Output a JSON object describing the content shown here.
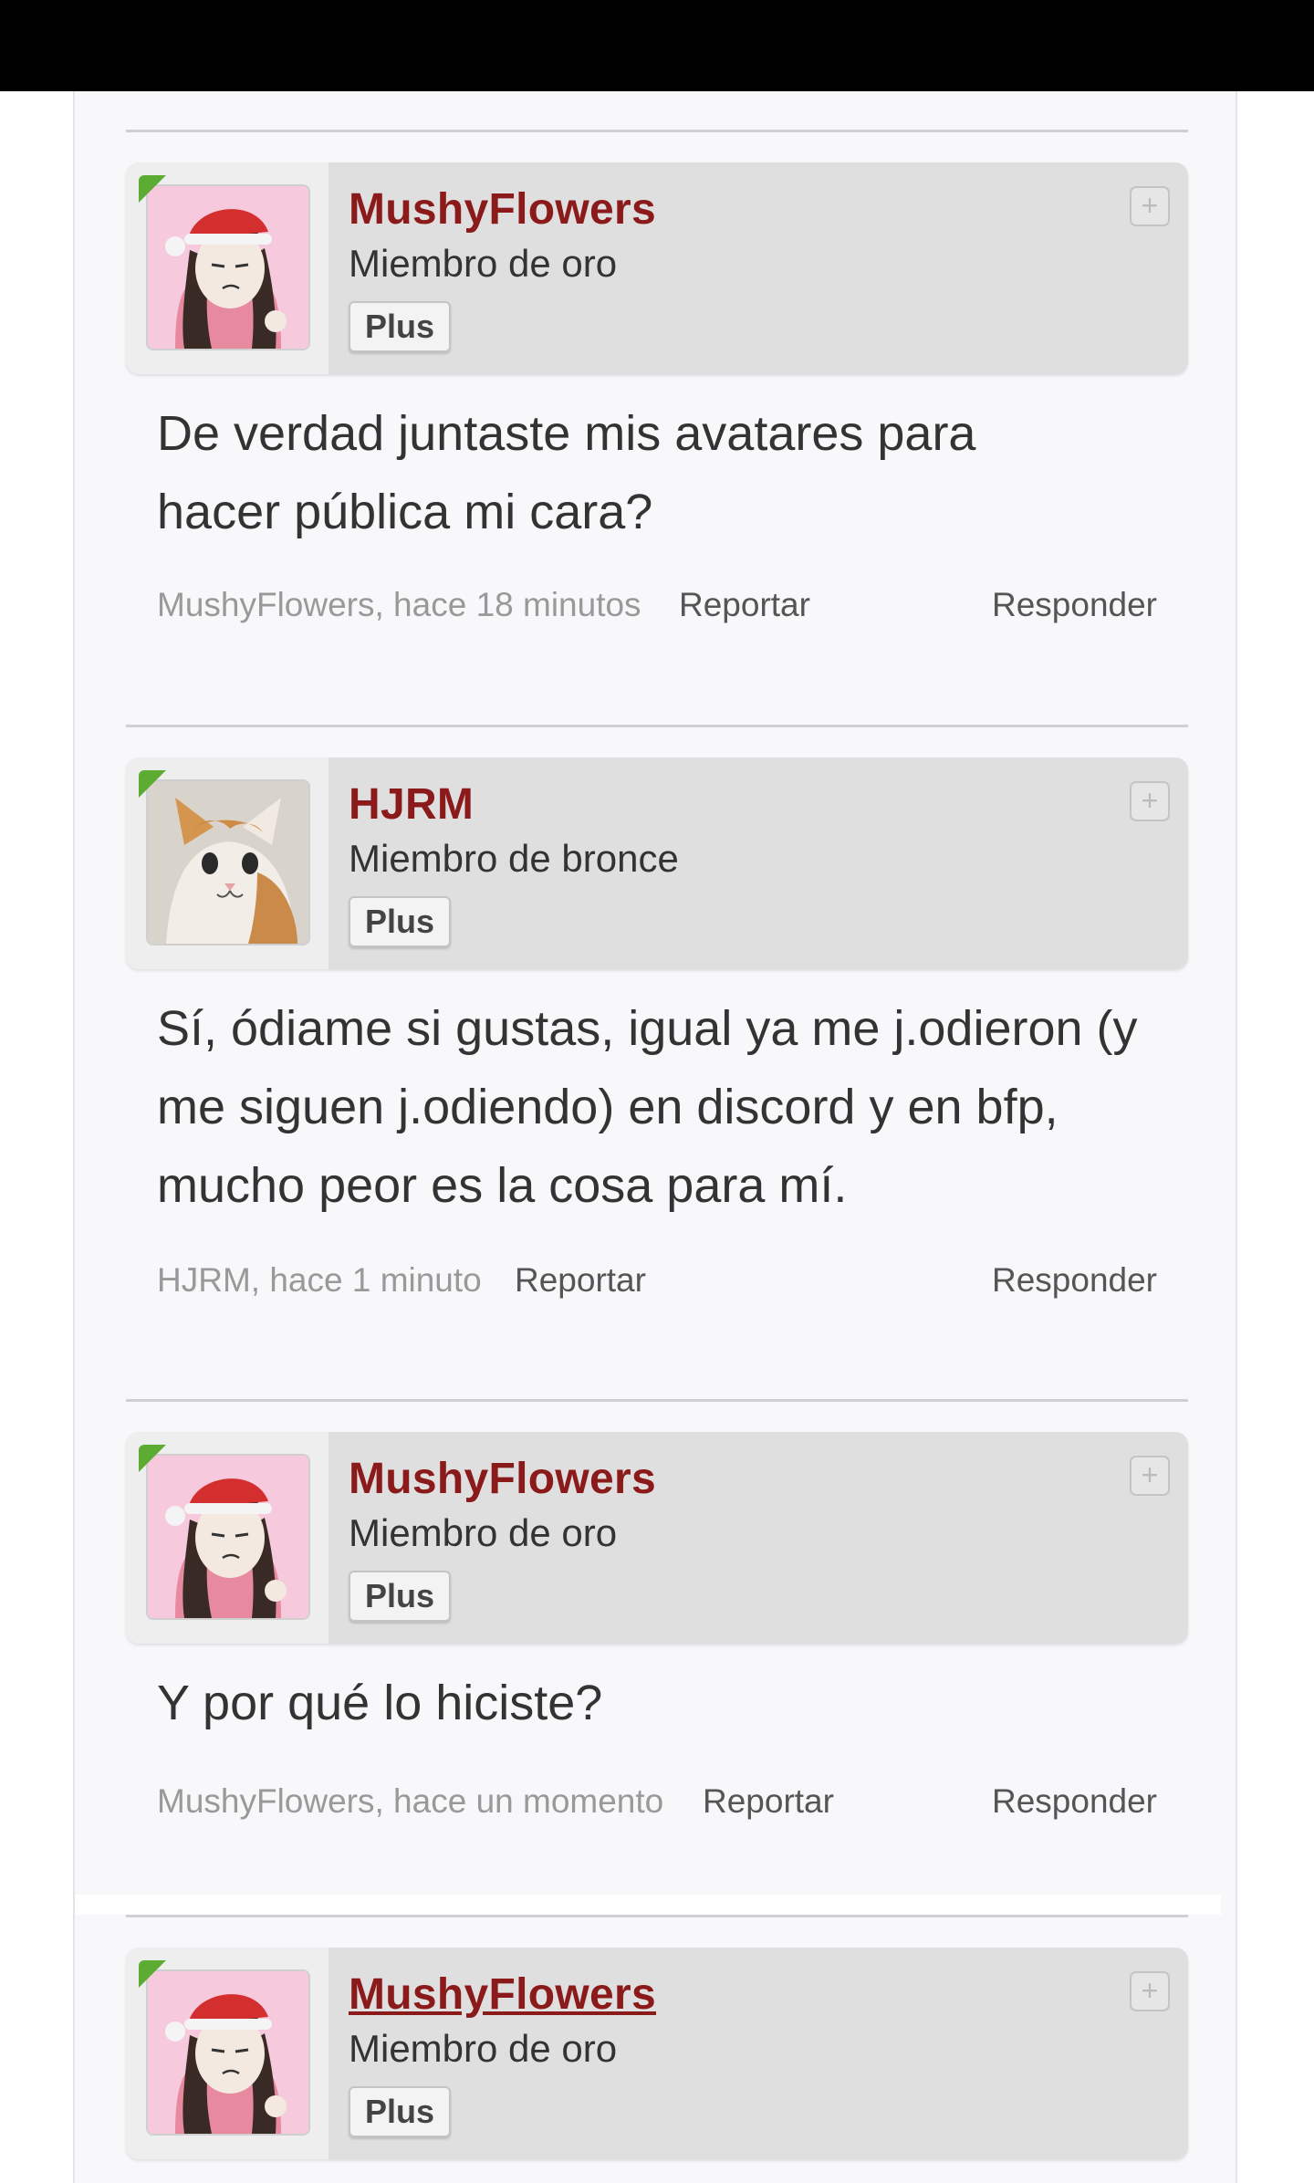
{
  "posts": [
    {
      "author": "MushyFlowers",
      "rank": "Miembro de oro",
      "badge": "Plus",
      "body": "De verdad juntaste mis avatares para hacer pública mi cara?",
      "meta": "MushyFlowers, hace 18 minutos",
      "report": "Reportar",
      "reply": "Responder",
      "avatar": "christmas-girl-avatar",
      "expand_icon": "plus-square-icon"
    },
    {
      "author": "HJRM",
      "rank": "Miembro de bronce",
      "badge": "Plus",
      "body": "Sí, ódiame si gustas, igual ya me j.odieron (y me siguen j.odiendo) en discord y en bfp, mucho peor es la cosa para mí.",
      "meta": "HJRM, hace 1 minuto",
      "report": "Reportar",
      "reply": "Responder",
      "avatar": "cat-avatar",
      "expand_icon": "plus-square-icon"
    },
    {
      "author": "MushyFlowers",
      "rank": "Miembro de oro",
      "badge": "Plus",
      "body": "Y por qué lo hiciste?",
      "meta": "MushyFlowers, hace un momento",
      "report": "Reportar",
      "reply": "Responder",
      "avatar": "christmas-girl-avatar",
      "expand_icon": "plus-square-icon"
    },
    {
      "author": "MushyFlowers",
      "rank": "Miembro de oro",
      "badge": "Plus",
      "avatar": "christmas-girl-avatar",
      "expand_icon": "plus-square-icon"
    }
  ],
  "colors": {
    "username": "#8b1a1a",
    "online_tab": "#5cab32",
    "card_bg": "#dfdfe0"
  }
}
